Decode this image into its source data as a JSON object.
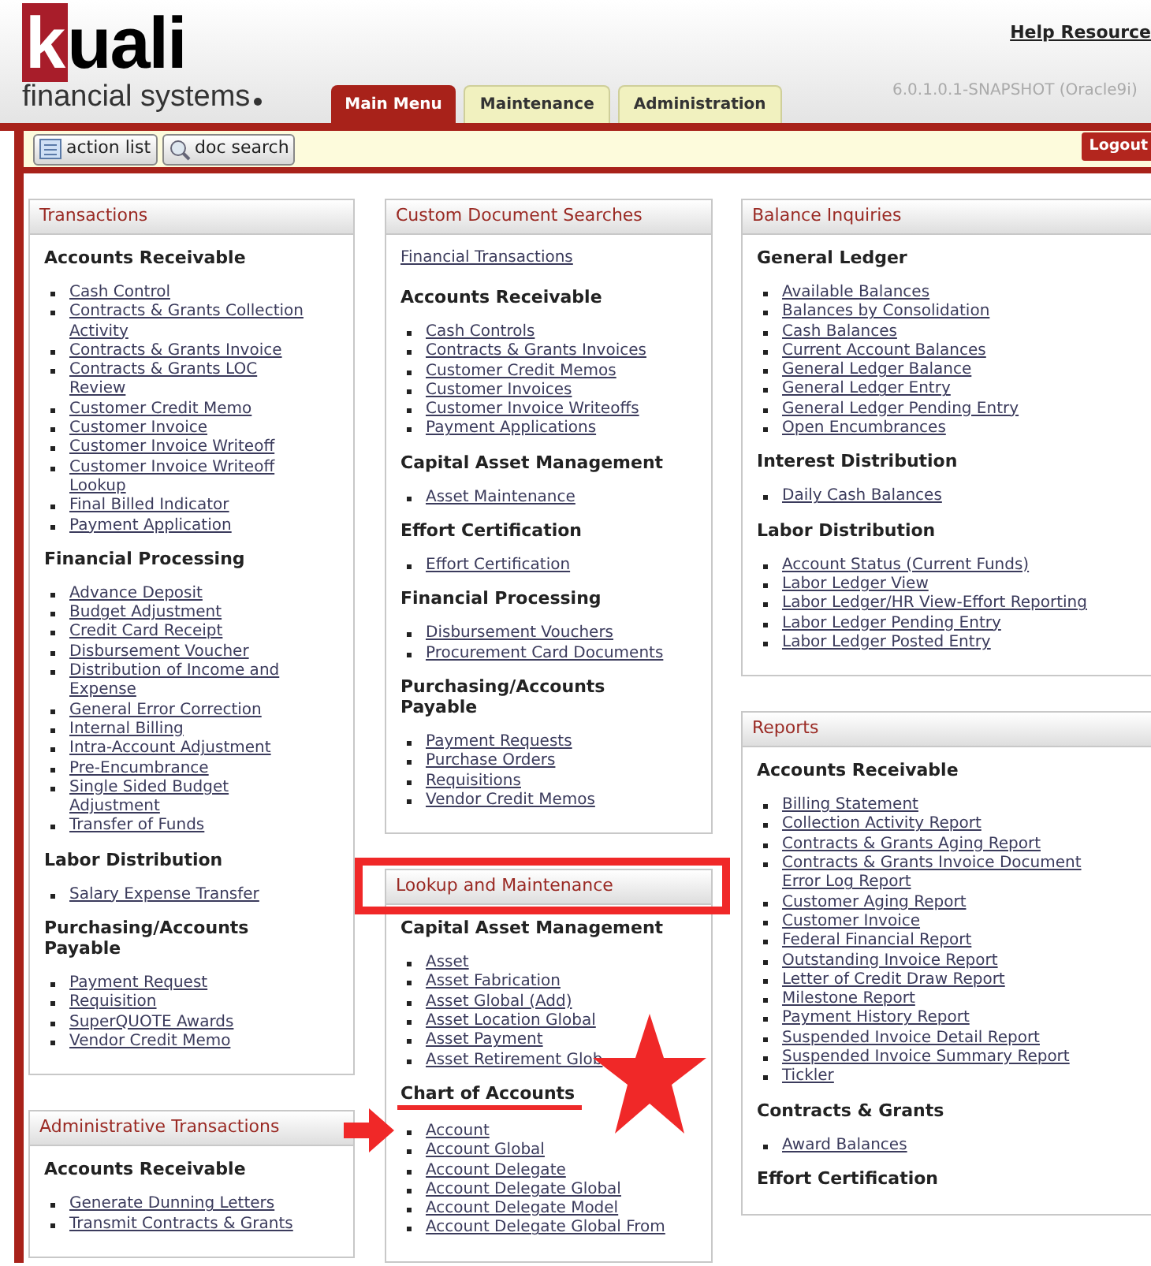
{
  "logo": {
    "initial": "k",
    "rest": "uali",
    "tagline": "financial systems"
  },
  "help_link": "Help Resource",
  "tabs": [
    {
      "label": "Main Menu",
      "selected": true
    },
    {
      "label": "Maintenance",
      "selected": false
    },
    {
      "label": "Administration",
      "selected": false
    }
  ],
  "version": "6.0.1.0.1-SNAPSHOT (Oracle9i)",
  "toolbar": {
    "buttons": [
      {
        "label": "action list"
      },
      {
        "label": "doc search"
      }
    ],
    "logout": "Logout"
  },
  "columns": [
    [
      {
        "title": "Transactions",
        "highlighted": false,
        "sections": [
          {
            "kind": "list",
            "heading": "Accounts Receivable",
            "marked": false,
            "links": [
              "Cash Control",
              "Contracts & Grants Collection Activity",
              "Contracts & Grants Invoice",
              "Contracts & Grants LOC Review",
              "Customer Credit Memo",
              "Customer Invoice",
              "Customer Invoice Writeoff",
              "Customer Invoice Writeoff Lookup",
              "Final Billed Indicator",
              "Payment Application"
            ]
          },
          {
            "kind": "list",
            "heading": "Financial Processing",
            "marked": false,
            "links": [
              "Advance Deposit",
              "Budget Adjustment",
              "Credit Card Receipt",
              "Disbursement Voucher",
              "Distribution of Income and Expense",
              "General Error Correction",
              "Internal Billing",
              "Intra-Account Adjustment",
              "Pre-Encumbrance",
              "Single Sided Budget Adjustment",
              "Transfer of Funds"
            ]
          },
          {
            "kind": "list",
            "heading": "Labor Distribution",
            "marked": false,
            "links": [
              "Salary Expense Transfer"
            ]
          },
          {
            "kind": "list",
            "heading": "Purchasing/Accounts Payable",
            "marked": false,
            "links": [
              "Payment Request",
              "Requisition",
              "SuperQUOTE Awards",
              "Vendor Credit Memo"
            ]
          }
        ]
      },
      {
        "title": "Administrative Transactions",
        "highlighted": false,
        "sections": [
          {
            "kind": "list",
            "heading": "Accounts Receivable",
            "marked": false,
            "links": [
              "Generate Dunning Letters",
              "Transmit Contracts & Grants"
            ]
          }
        ]
      }
    ],
    [
      {
        "title": "Custom Document Searches",
        "highlighted": false,
        "sections": [
          {
            "kind": "plain",
            "links": [
              "Financial Transactions"
            ]
          },
          {
            "kind": "list",
            "heading": "Accounts Receivable",
            "marked": false,
            "links": [
              "Cash Controls",
              "Contracts & Grants Invoices",
              "Customer Credit Memos",
              "Customer Invoices",
              "Customer Invoice Writeoffs",
              "Payment Applications"
            ]
          },
          {
            "kind": "list",
            "heading": "Capital Asset Management",
            "marked": false,
            "links": [
              "Asset Maintenance"
            ]
          },
          {
            "kind": "list",
            "heading": "Effort Certification",
            "marked": false,
            "links": [
              "Effort Certification"
            ]
          },
          {
            "kind": "list",
            "heading": "Financial Processing",
            "marked": false,
            "links": [
              "Disbursement Vouchers",
              "Procurement Card Documents"
            ]
          },
          {
            "kind": "list",
            "heading": "Purchasing/Accounts Payable",
            "marked": false,
            "links": [
              "Payment Requests",
              "Purchase Orders",
              "Requisitions",
              "Vendor Credit Memos"
            ]
          }
        ]
      },
      {
        "title": "Lookup and Maintenance",
        "highlighted": true,
        "sections": [
          {
            "kind": "list",
            "heading": "Capital Asset Management",
            "marked": false,
            "links": [
              "Asset",
              "Asset Fabrication",
              "Asset Global (Add)",
              "Asset Location Global",
              "Asset Payment",
              "Asset Retirement Glob"
            ]
          },
          {
            "kind": "list",
            "heading": "Chart of Accounts",
            "marked": true,
            "links": [
              "Account",
              "Account Global",
              "Account Delegate",
              "Account Delegate Global",
              "Account Delegate Model",
              "Account Delegate Global From"
            ]
          }
        ]
      }
    ],
    [
      {
        "title": "Balance Inquiries",
        "highlighted": false,
        "sections": [
          {
            "kind": "list",
            "heading": "General Ledger",
            "marked": false,
            "links": [
              "Available Balances",
              "Balances by Consolidation",
              "Cash Balances",
              "Current Account Balances",
              "General Ledger Balance",
              "General Ledger Entry",
              "General Ledger Pending Entry",
              "Open Encumbrances"
            ]
          },
          {
            "kind": "list",
            "heading": "Interest Distribution",
            "marked": false,
            "links": [
              "Daily Cash Balances"
            ]
          },
          {
            "kind": "list",
            "heading": "Labor Distribution",
            "marked": false,
            "links": [
              "Account Status (Current Funds)",
              "Labor Ledger View",
              "Labor Ledger/HR View-Effort Reporting",
              "Labor Ledger Pending Entry",
              "Labor Ledger Posted Entry"
            ]
          }
        ]
      },
      {
        "title": "Reports",
        "highlighted": false,
        "sections": [
          {
            "kind": "list",
            "heading": "Accounts Receivable",
            "marked": false,
            "links": [
              "Billing Statement",
              "Collection Activity Report",
              "Contracts & Grants Aging Report",
              "Contracts & Grants Invoice Document Error Log Report",
              "Customer Aging Report",
              "Customer Invoice",
              "Federal Financial Report",
              "Outstanding Invoice Report",
              "Letter of Credit Draw Report",
              "Milestone Report",
              "Payment History Report",
              "Suspended Invoice Detail Report",
              "Suspended Invoice Summary Report",
              "Tickler"
            ]
          },
          {
            "kind": "list",
            "heading": "Contracts & Grants",
            "marked": false,
            "links": [
              "Award Balances"
            ]
          },
          {
            "kind": "list",
            "heading": "Effort Certification",
            "marked": false
          }
        ]
      }
    ]
  ]
}
